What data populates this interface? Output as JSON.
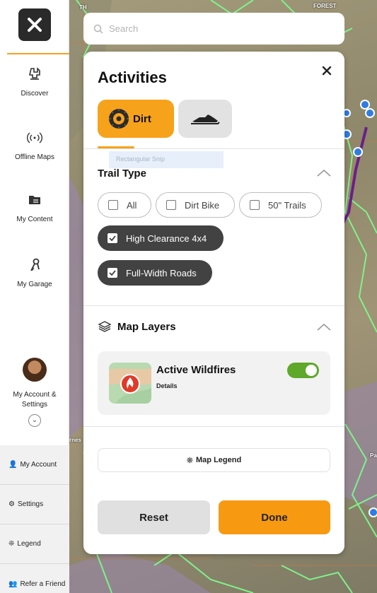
{
  "map": {
    "labels": [
      "TH",
      "FOREST",
      "rnes",
      "Pa"
    ]
  },
  "rail": {
    "nav": [
      {
        "label": "Discover",
        "icon": "binoculars-icon"
      },
      {
        "label": "Offline Maps",
        "icon": "signal-icon"
      },
      {
        "label": "My Content",
        "icon": "folder-icon"
      },
      {
        "label": "My Garage",
        "icon": "keys-icon"
      }
    ],
    "account": {
      "label_line1": "My Account &",
      "label_line2": "Settings",
      "expand_glyph": "⌄"
    },
    "links": [
      {
        "label": "My Account",
        "glyph": "👤"
      },
      {
        "label": "Settings",
        "glyph": "⚙"
      },
      {
        "label": "Legend",
        "glyph": "❊"
      },
      {
        "label": "Refer a Friend",
        "glyph": "👥"
      }
    ]
  },
  "search": {
    "placeholder": "Search"
  },
  "panel": {
    "title": "Activities",
    "activities": [
      {
        "label": "Dirt",
        "selected": true
      },
      {
        "label": "",
        "icon": "snowmobile-icon",
        "selected": false
      }
    ],
    "snip_text": "Rectangular Snip",
    "trail_type": {
      "heading": "Trail Type",
      "options": [
        {
          "label": "All",
          "checked": false
        },
        {
          "label": "Dirt Bike",
          "checked": false
        },
        {
          "label": "50\" Trails",
          "checked": false
        },
        {
          "label": "High Clearance 4x4",
          "checked": true
        },
        {
          "label": "Full-Width Roads",
          "checked": true
        }
      ]
    },
    "map_layers": {
      "heading": "Map Layers",
      "layer": {
        "name": "Active Wildfires",
        "details": "Details",
        "enabled": true
      }
    },
    "legend_button": "Map Legend",
    "reset_button": "Reset",
    "done_button": "Done"
  },
  "colors": {
    "accent": "#f7a21b",
    "done": "#f79a12",
    "chip_on": "#424242",
    "toggle_on": "#5fa82a",
    "trail": "#7ff28a",
    "route": "#6a1f8a",
    "marker": "#2f7de0"
  }
}
